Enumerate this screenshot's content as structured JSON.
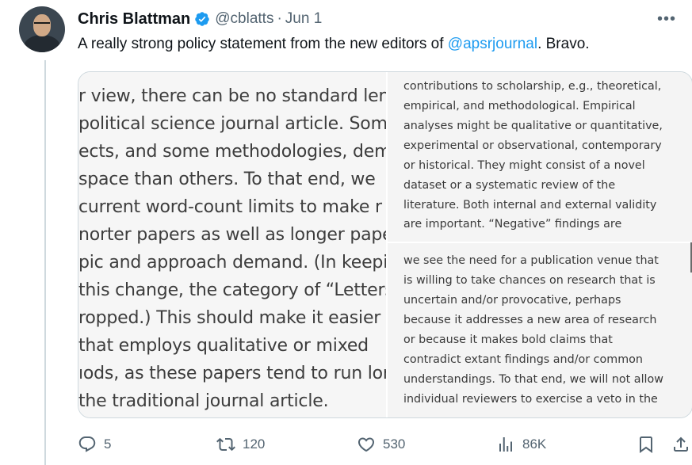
{
  "author": {
    "name": "Chris Blattman",
    "handle": "@cblatts",
    "separator": "·",
    "date": "Jun 1",
    "verified": true
  },
  "tweet": {
    "text_before": "A really strong policy statement from the new editors of ",
    "mention": "@apsrjournal",
    "text_after": ". Bravo."
  },
  "media": {
    "left_lines": [
      "r view, there can be no standard len",
      " political science journal article. Som",
      "ects, and some methodologies, dema",
      "space than others. To that end, we",
      " current word-count limits to make r",
      "norter papers as well as longer pape",
      "pic and approach demand. (In keepi",
      "this change, the category of “Letters",
      "ropped.) This should make it easier fo",
      " that employs qualitative or mixed",
      "ıods, as these papers tend to run lon",
      "the traditional journal article."
    ],
    "right_lines": [
      "contributions to scholarship, e.g., theoretical,",
      "empirical, and methodological. Empirical",
      "analyses might be qualitative or quantitative,",
      "experimental or observational, contemporary",
      "or historical. They might consist of a novel",
      "dataset or a systematic review of the",
      "literature. Both internal and external validity",
      "are important. “Negative” findings are",
      "we see the need for a publication venue that",
      "is willing to take chances on research that is",
      "uncertain and/or provocative, perhaps",
      "because it addresses a new area of research",
      "or because it makes bold claims that",
      "contradict extant findings and/or common",
      "understandings. To that end, we will not allow",
      "individual reviewers to exercise a veto in the"
    ]
  },
  "actions": {
    "replies": "5",
    "retweets": "120",
    "likes": "530",
    "views": "86K"
  },
  "colors": {
    "accent": "#1d9bf0",
    "muted": "#536471",
    "text": "#0f1419",
    "border": "#cfd9de"
  },
  "icons": [
    "verified-badge-icon",
    "more-icon",
    "reply-icon",
    "retweet-icon",
    "like-icon",
    "views-icon",
    "bookmark-icon",
    "share-icon"
  ]
}
